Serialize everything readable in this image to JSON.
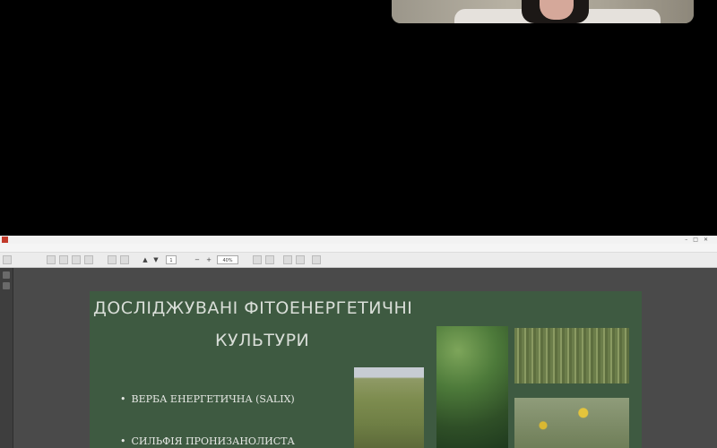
{
  "slide": {
    "title_line1": "ДОСЛІДЖУВАНІ ФІТОЕНЕРГЕТИЧНІ",
    "title_line2": "КУЛЬТУРИ",
    "bullets": [
      "ВЕРБА ЕНЕРГЕТИЧНА (SALIX)",
      "СИЛЬФІЯ ПРОНИЗАНОЛИСТА"
    ]
  },
  "toolbar": {
    "page_number": "1",
    "zoom": "40%"
  },
  "colors": {
    "slide_background": "#3e5a41",
    "viewer_background": "#4a4a4a",
    "call_background": "#000000"
  }
}
